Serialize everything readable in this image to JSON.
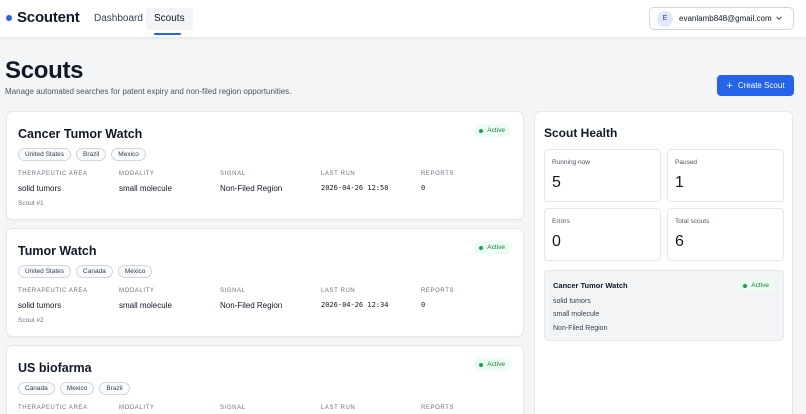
{
  "header": {
    "brand": "Scoutent",
    "nav": [
      {
        "label": "Dashboard",
        "active": false
      },
      {
        "label": "Scouts",
        "active": true
      }
    ],
    "account": {
      "avatar_initial": "E",
      "email": "evanlamb848@gmail.com"
    }
  },
  "page": {
    "title": "Scouts",
    "subtitle": "Manage automated searches for patent expiry and non-filed region opportunities.",
    "create_button": {
      "icon": "plus-icon",
      "label": "Create Scout"
    }
  },
  "field_labels": {
    "therapeutic_area": "THERAPEUTIC AREA",
    "modality": "MODALITY",
    "signal": "SIGNAL",
    "last_run": "LAST RUN",
    "reports": "REPORTS"
  },
  "scouts": [
    {
      "title": "Cancer Tumor Watch",
      "status": "Active",
      "regions": [
        "United States",
        "Brazil",
        "Mexico"
      ],
      "therapeutic_area": "solid tumors",
      "modality": "small molecule",
      "signal": "Non-Filed Region",
      "last_run": "2026-04-26 12:50",
      "reports": "0",
      "footer": "Scout #1"
    },
    {
      "title": "Tumor Watch",
      "status": "Active",
      "regions": [
        "United States",
        "Canada",
        "Mexico"
      ],
      "therapeutic_area": "solid tumors",
      "modality": "small molecule",
      "signal": "Non-Filed Region",
      "last_run": "2026-04-26 12:34",
      "reports": "0",
      "footer": "Scout #2"
    },
    {
      "title": "US biofarma",
      "status": "Active",
      "regions": [
        "Canada",
        "Mexico",
        "Brazil"
      ],
      "therapeutic_area": "",
      "modality": "",
      "signal": "",
      "last_run": "",
      "reports": "",
      "footer": ""
    }
  ],
  "health": {
    "title": "Scout Health",
    "stats": [
      {
        "label": "Running now",
        "value": "5"
      },
      {
        "label": "Paused",
        "value": "1"
      },
      {
        "label": "Errors",
        "value": "0"
      },
      {
        "label": "Total scouts",
        "value": "6"
      }
    ],
    "preview": {
      "title": "Cancer Tumor Watch",
      "status": "Active",
      "lines": [
        "solid tumors",
        "small molecule",
        "Non-Filed Region"
      ]
    }
  },
  "colors": {
    "accent": "#2563eb",
    "status_active_bg": "#ecfdf3",
    "status_active_text": "#15803d",
    "page_bg": "#f4f5f7"
  }
}
